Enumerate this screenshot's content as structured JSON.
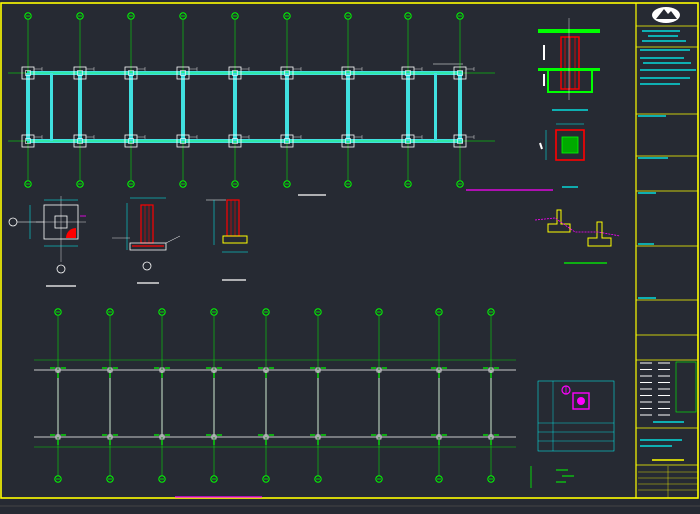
{
  "colors": {
    "background": "#262a33",
    "frame": "#ffff00",
    "beam": "#40e0e0",
    "grid_marker": "#00ff00",
    "dimension": "#00ffff",
    "section_rebar": "#ff0000",
    "section_outline": "#ffff00",
    "leader": "#ff00ff",
    "line_white": "#ffffff"
  },
  "title_block": {
    "logo_icon": "mountain-emblem-icon"
  },
  "drawing": {
    "plan_top_axes": 9,
    "plan_bottom_axes": 9
  }
}
